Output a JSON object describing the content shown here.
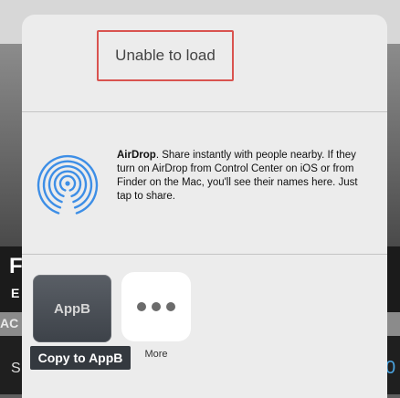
{
  "background": {
    "letter_f": "F",
    "letter_e": "E",
    "letters_ac": "AC",
    "letter_s": "S",
    "digit_zero": "0"
  },
  "share_sheet": {
    "header": {
      "status": "Unable to load"
    },
    "airdrop": {
      "title": "AirDrop",
      "description": ". Share instantly with people nearby. If they turn on AirDrop from Control Center on iOS or from Finder on the Mac, you'll see their names here. Just tap to share."
    },
    "apps": [
      {
        "tile_text": "AppB",
        "label": "Copy to AppB"
      },
      {
        "label": "More"
      }
    ]
  },
  "colors": {
    "highlight_border": "#d9534f",
    "airdrop_blue": "#3d8ee6",
    "sheet_background": "#ececec"
  },
  "icons": {
    "airdrop": "airdrop-icon",
    "more": "more-dots-icon"
  }
}
